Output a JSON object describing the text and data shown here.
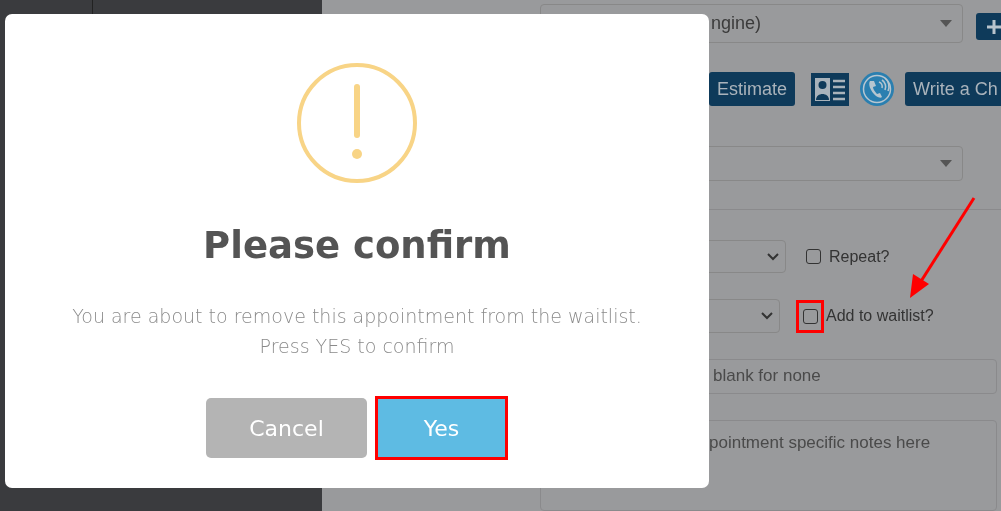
{
  "background_form": {
    "vehicle_select": {
      "value": "ngine)"
    },
    "actions": [
      {
        "kind": "button",
        "label": "Estimate"
      },
      {
        "kind": "contact-card"
      },
      {
        "kind": "phone"
      },
      {
        "kind": "button",
        "label": "Write a Ch"
      }
    ],
    "repeat": {
      "label": "Repeat?",
      "checked": false
    },
    "waitlist": {
      "label": "Add to waitlist?",
      "checked": false
    },
    "reference_field": {
      "placeholder": "blank for none"
    },
    "notes_field": {
      "placeholder": "pointment specific notes here"
    }
  },
  "dialog": {
    "title": "Please confirm",
    "message": [
      "You are about to remove this appointment from the waitlist.",
      "Press YES to confirm"
    ],
    "buttons": [
      {
        "kind": "cancel",
        "label": "Cancel"
      },
      {
        "kind": "confirm",
        "label": "Yes"
      }
    ]
  }
}
